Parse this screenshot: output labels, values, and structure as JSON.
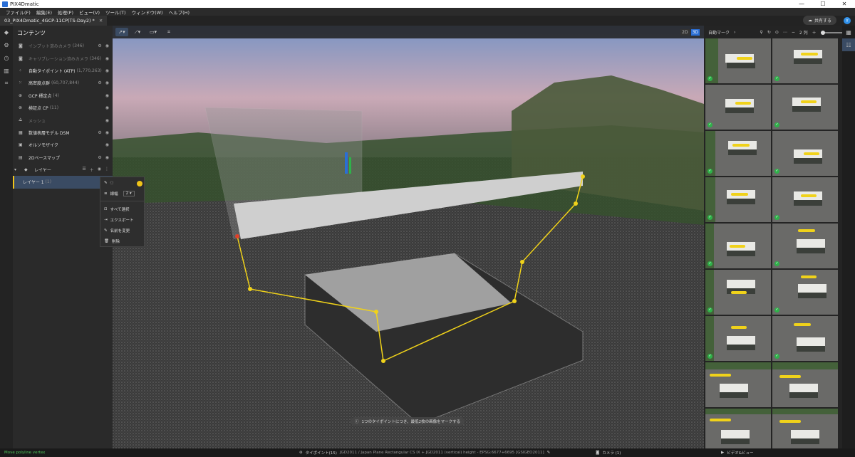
{
  "app": {
    "title": "PIX4Dmatic"
  },
  "window_controls": {
    "minimize": "—",
    "maximize": "☐",
    "close": "✕"
  },
  "menu": [
    "ファイル(F)",
    "編集(E)",
    "処理(P)",
    "ビュー(V)",
    "ツール(T)",
    "ウィンドウ(W)",
    "ヘルプ(H)"
  ],
  "tab": {
    "label": "03_PIX4Dmatic_4GCP-11CP(TS-Day2) *",
    "close": "✕"
  },
  "header": {
    "share_label": "共有する",
    "avatar": "Y"
  },
  "contents": {
    "title": "コンテンツ",
    "items": [
      {
        "label": "インプット済みカメラ",
        "count": "(346)",
        "dim": true
      },
      {
        "label": "キャリブレーション済みカメラ",
        "count": "(346)",
        "dim": true
      },
      {
        "label": "自動タイポイント (ATP)",
        "count": "(1,770,263)",
        "dim": false
      },
      {
        "label": "高密度点群",
        "count": "(60,707,844)",
        "dim": false
      },
      {
        "label": "GCP 標定点",
        "count": "(4)",
        "dim": false
      },
      {
        "label": "検証点 CP",
        "count": "(11)",
        "dim": false
      },
      {
        "label": "メッシュ",
        "count": "",
        "dim": true
      },
      {
        "label": "数値表層モデル DSM",
        "count": "",
        "dim": false
      },
      {
        "label": "オルソモザイク",
        "count": "",
        "dim": false
      },
      {
        "label": "2Dベースマップ",
        "count": "",
        "dim": false
      },
      {
        "label": "レイヤー",
        "count": "",
        "dim": false
      },
      {
        "label": "レイヤー 1",
        "count": "(1)",
        "dim": false
      }
    ]
  },
  "context_menu": {
    "line_width_label": "線幅",
    "line_width_value": "2",
    "items": [
      "すべて選択",
      "エクスポート",
      "名前を変更",
      "削除"
    ]
  },
  "viewport": {
    "mode_2d": "2D",
    "mode_3d": "3D",
    "toast": "1つのタイポイントにつき、最低2枚の画像をマークする"
  },
  "right_panel": {
    "auto_mark_label": "自動マーク",
    "columns_label": "2 列"
  },
  "status": {
    "left": "Move polyline vertex",
    "tiepoints_label": "タイポイント(15)",
    "crs": "JGD2011 / Japan Plane Rectangular CS IX + JGD2011 (vertical) height - EPSG:6677+6695 [GSIGEO2011]",
    "camera_label": "カメラ (1)",
    "video_label": "ビデオ&ビュー"
  },
  "colors": {
    "accent": "#2a6fd6",
    "polyline": "#f0d21a",
    "selection": "#3a4b63"
  }
}
